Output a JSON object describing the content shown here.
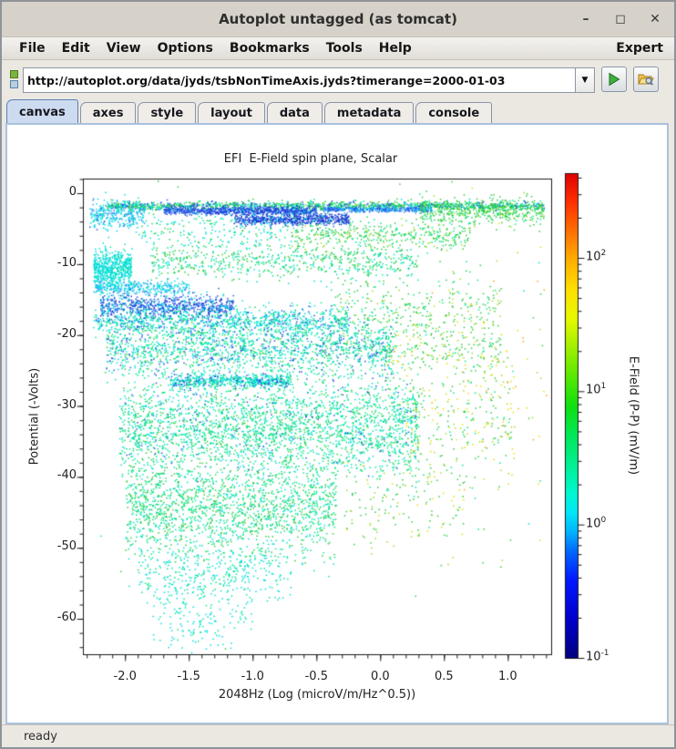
{
  "window": {
    "title": "Autoplot untagged (as tomcat)",
    "controls": {
      "minimize": "–",
      "maximize": "◻",
      "close": "✕"
    }
  },
  "menu": {
    "items": [
      "File",
      "Edit",
      "View",
      "Options",
      "Bookmarks",
      "Tools",
      "Help"
    ],
    "right_item": "Expert"
  },
  "address_bar": {
    "url": "http://autoplot.org/data/jyds/tsbNonTimeAxis.jyds?timerange=2000-01-03",
    "dropdown_glyph": "▼",
    "icons": [
      "datasource-status-icon",
      "play-icon",
      "open-folder-icon"
    ]
  },
  "tabs": {
    "items": [
      "canvas",
      "axes",
      "style",
      "layout",
      "data",
      "metadata",
      "console"
    ],
    "selected": "canvas"
  },
  "statusbar": {
    "text": "ready"
  },
  "chart_data": {
    "type": "scatter",
    "title": "EFI  E-Field spin plane, Scalar",
    "xlabel": "2048Hz (Log (microV/m/Hz^0.5))",
    "ylabel": "Potential (-Volts)",
    "xlim": [
      -2.33,
      1.34
    ],
    "ylim": [
      -65,
      2.06
    ],
    "grid": false,
    "xticks": [
      {
        "label": "-2.0",
        "value": -2.0
      },
      {
        "label": "-1.5",
        "value": -1.5
      },
      {
        "label": "-1.0",
        "value": -1.0
      },
      {
        "label": "-0.5",
        "value": -0.5
      },
      {
        "label": "0.0",
        "value": 0.0
      },
      {
        "label": "0.5",
        "value": 0.5
      },
      {
        "label": "1.0",
        "value": 1.0
      }
    ],
    "x_minor_step": 0.1,
    "yticks": [
      {
        "label": "0",
        "value": 0
      },
      {
        "label": "-10",
        "value": -10
      },
      {
        "label": "-20",
        "value": -20
      },
      {
        "label": "-30",
        "value": -30
      },
      {
        "label": "-40",
        "value": -40
      },
      {
        "label": "-50",
        "value": -50
      },
      {
        "label": "-60",
        "value": -60
      }
    ],
    "y_minor_step": 2,
    "colorbar": {
      "label": "E-Field (P-P) (mV/m)",
      "scale": "log",
      "min": 0.1,
      "max": 432,
      "ticks": [
        {
          "base": "10",
          "exp": "2",
          "value": 100
        },
        {
          "base": "10",
          "exp": "1",
          "value": 10
        },
        {
          "base": "10",
          "exp": "0",
          "value": 1
        },
        {
          "base": "10",
          "exp": "-1",
          "value": 0.1
        }
      ],
      "gradient": [
        [
          0.0,
          "#000080"
        ],
        [
          0.08,
          "#0000cd"
        ],
        [
          0.16,
          "#0018ff"
        ],
        [
          0.22,
          "#0068ff"
        ],
        [
          0.26,
          "#00b4ff"
        ],
        [
          0.3,
          "#00e8f8"
        ],
        [
          0.34,
          "#00f8d0"
        ],
        [
          0.4,
          "#00f090"
        ],
        [
          0.46,
          "#00e858"
        ],
        [
          0.52,
          "#10e010"
        ],
        [
          0.58,
          "#58e800"
        ],
        [
          0.64,
          "#a0f000"
        ],
        [
          0.7,
          "#e8f800"
        ],
        [
          0.76,
          "#ffe000"
        ],
        [
          0.82,
          "#ffb000"
        ],
        [
          0.88,
          "#ff7000"
        ],
        [
          0.94,
          "#ff3000"
        ],
        [
          1.0,
          "#e00000"
        ]
      ]
    },
    "palette": {
      "dblue": "#1836c8",
      "blue": "#2a52e8",
      "lblue": "#2e9aff",
      "cyan": "#00dcdc",
      "teal": "#00e890",
      "green": "#2ecc44",
      "ygreen": "#a0dc20",
      "yellow": "#e8dc00",
      "orange": "#ffa020"
    },
    "seed": 20000103,
    "clusters": [
      {
        "x": [
          -2.15,
          1.28
        ],
        "y": -1.7,
        "ysd": 0.3,
        "n": 1500,
        "c": [
          [
            "green",
            0.45
          ],
          [
            "teal",
            0.2
          ],
          [
            "cyan",
            0.15
          ],
          [
            "blue",
            0.2
          ]
        ]
      },
      {
        "x": [
          -1.7,
          -0.5
        ],
        "y": -2.4,
        "ysd": 0.3,
        "n": 800,
        "c": [
          [
            "blue",
            0.65
          ],
          [
            "dblue",
            0.25
          ],
          [
            "cyan",
            0.1
          ]
        ]
      },
      {
        "x": [
          -0.45,
          0.4
        ],
        "y": -2.2,
        "ysd": 0.18,
        "n": 380,
        "c": [
          [
            "lblue",
            0.55
          ],
          [
            "blue",
            0.35
          ],
          [
            "cyan",
            0.1
          ]
        ]
      },
      {
        "x": [
          -1.15,
          -0.25
        ],
        "y": -3.6,
        "ysd": 0.4,
        "n": 650,
        "c": [
          [
            "dblue",
            0.55
          ],
          [
            "blue",
            0.35
          ],
          [
            "cyan",
            0.1
          ]
        ]
      },
      {
        "x": [
          -2.28,
          -1.85
        ],
        "y": -3.0,
        "ysd": 1.0,
        "n": 300,
        "c": [
          [
            "cyan",
            0.7
          ],
          [
            "lblue",
            0.2
          ],
          [
            "blue",
            0.1
          ]
        ]
      },
      {
        "x": [
          0.3,
          1.28
        ],
        "y": -2.5,
        "ysd": 0.9,
        "n": 450,
        "c": [
          [
            "green",
            0.7
          ],
          [
            "teal",
            0.2
          ],
          [
            "ygreen",
            0.1
          ]
        ]
      },
      {
        "x": [
          -0.7,
          0.7
        ],
        "y": -5.8,
        "ysd": 1.1,
        "n": 420,
        "c": [
          [
            "green",
            0.55
          ],
          [
            "teal",
            0.3
          ],
          [
            "ygreen",
            0.15
          ]
        ]
      },
      {
        "x": [
          -1.9,
          -0.7
        ],
        "y": -5.5,
        "ysd": 1.3,
        "n": 200,
        "c": [
          [
            "cyan",
            0.5
          ],
          [
            "teal",
            0.3
          ],
          [
            "green",
            0.2
          ]
        ]
      },
      {
        "x": [
          -2.25,
          -1.95
        ],
        "y": -10.5,
        "ysd": 1.3,
        "n": 550,
        "c": [
          [
            "cyan",
            0.85
          ],
          [
            "teal",
            0.15
          ]
        ]
      },
      {
        "x": [
          -1.8,
          0.3
        ],
        "y": -9.6,
        "ysd": 1.1,
        "n": 600,
        "c": [
          [
            "green",
            0.4
          ],
          [
            "teal",
            0.35
          ],
          [
            "cyan",
            0.25
          ]
        ]
      },
      {
        "x": [
          -2.25,
          -1.5
        ],
        "y": -13.2,
        "ysd": 0.5,
        "n": 320,
        "c": [
          [
            "cyan",
            0.75
          ],
          [
            "lblue",
            0.25
          ]
        ]
      },
      {
        "x": [
          -2.2,
          -1.15
        ],
        "y": -15.8,
        "ysd": 0.8,
        "n": 700,
        "c": [
          [
            "blue",
            0.45
          ],
          [
            "dblue",
            0.3
          ],
          [
            "cyan",
            0.25
          ]
        ]
      },
      {
        "x": [
          -2.25,
          -0.25
        ],
        "y": -17.9,
        "ysd": 1.0,
        "n": 950,
        "c": [
          [
            "cyan",
            0.5
          ],
          [
            "teal",
            0.3
          ],
          [
            "blue",
            0.2
          ]
        ]
      },
      {
        "x": [
          -0.4,
          0.95
        ],
        "y": -16.0,
        "ysd": 2.6,
        "n": 320,
        "c": [
          [
            "green",
            0.6
          ],
          [
            "teal",
            0.25
          ],
          [
            "ygreen",
            0.15
          ]
        ]
      },
      {
        "x": [
          -2.15,
          0.1
        ],
        "y": -21.7,
        "ysd": 1.9,
        "n": 1700,
        "c": [
          [
            "teal",
            0.45
          ],
          [
            "cyan",
            0.3
          ],
          [
            "blue",
            0.15
          ],
          [
            "green",
            0.1
          ]
        ]
      },
      {
        "x": [
          0.0,
          0.95
        ],
        "y": -22.0,
        "ysd": 2.2,
        "n": 240,
        "c": [
          [
            "green",
            0.5
          ],
          [
            "ygreen",
            0.2
          ],
          [
            "teal",
            0.2
          ],
          [
            "yellow",
            0.1
          ]
        ]
      },
      {
        "x": [
          -1.65,
          -0.7
        ],
        "y": -26.4,
        "ysd": 0.45,
        "n": 550,
        "c": [
          [
            "cyan",
            0.5
          ],
          [
            "teal",
            0.25
          ],
          [
            "blue",
            0.15
          ],
          [
            "dblue",
            0.1
          ]
        ]
      },
      {
        "x": [
          -2.05,
          0.3
        ],
        "y": -33.0,
        "ysd": 3.6,
        "n": 2800,
        "c": [
          [
            "teal",
            0.5
          ],
          [
            "cyan",
            0.25
          ],
          [
            "green",
            0.2
          ],
          [
            "blue",
            0.05
          ]
        ]
      },
      {
        "x": [
          0.2,
          1.05
        ],
        "y": -32.0,
        "ysd": 4.5,
        "n": 280,
        "c": [
          [
            "green",
            0.4
          ],
          [
            "ygreen",
            0.25
          ],
          [
            "yellow",
            0.2
          ],
          [
            "teal",
            0.15
          ]
        ]
      },
      {
        "x": [
          -2.0,
          -0.35
        ],
        "y": -44.5,
        "ysd": 3.2,
        "n": 1600,
        "c": [
          [
            "teal",
            0.45
          ],
          [
            "green",
            0.35
          ],
          [
            "cyan",
            0.2
          ]
        ]
      },
      {
        "x": [
          -0.3,
          0.65
        ],
        "y": -44.0,
        "ysd": 3.2,
        "n": 130,
        "c": [
          [
            "green",
            0.5
          ],
          [
            "ygreen",
            0.3
          ],
          [
            "yellow",
            0.2
          ]
        ]
      },
      {
        "x": [
          -1.9,
          -0.7
        ],
        "y": -53.0,
        "ysd": 2.2,
        "n": 380,
        "c": [
          [
            "cyan",
            0.6
          ],
          [
            "teal",
            0.4
          ]
        ]
      },
      {
        "x": [
          -1.8,
          -1.0
        ],
        "y": -58.5,
        "ysd": 2.6,
        "n": 130,
        "c": [
          [
            "cyan",
            0.7
          ],
          [
            "teal",
            0.3
          ]
        ]
      },
      {
        "x": [
          -1.65,
          -1.2
        ],
        "y": -62.0,
        "ysd": 1.5,
        "n": 45,
        "c": [
          [
            "cyan",
            0.8
          ],
          [
            "teal",
            0.2
          ]
        ]
      },
      {
        "x": [
          0.35,
          1.3
        ],
        "y": -20.0,
        "ysd": 12.0,
        "n": 70,
        "c": [
          [
            "yellow",
            0.5
          ],
          [
            "ygreen",
            0.3
          ],
          [
            "orange",
            0.2
          ]
        ]
      },
      {
        "x": [
          -2.25,
          1.3
        ],
        "y": -10.0,
        "ysd": 26.0,
        "n": 160,
        "c": [
          [
            "green",
            0.5
          ],
          [
            "teal",
            0.3
          ],
          [
            "cyan",
            0.2
          ]
        ]
      }
    ]
  }
}
